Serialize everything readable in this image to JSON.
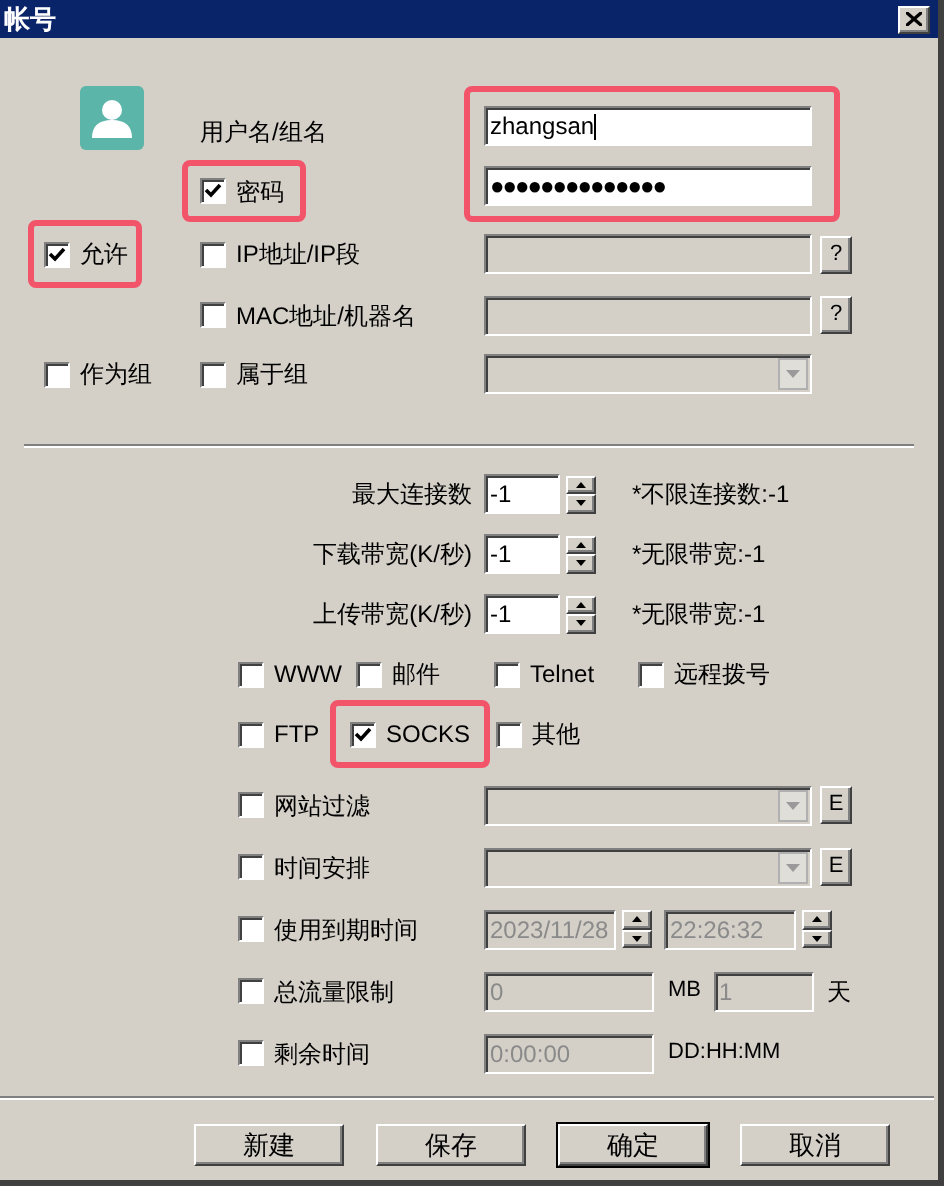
{
  "window": {
    "title": "帐号"
  },
  "identity": {
    "username_label": "用户名/组名",
    "username": "zhangsan",
    "password_value": "●●●●●●●●●●●●●●",
    "fields_highlighted": true
  },
  "password": {
    "label": "密码",
    "checked": true,
    "highlighted": true
  },
  "allow": {
    "label": "允许",
    "checked": true,
    "highlighted": true
  },
  "bindings": [
    {
      "label": "IP地址/IP段",
      "checked": false,
      "help": "?"
    },
    {
      "label": "MAC地址/机器名",
      "checked": false,
      "help": "?"
    }
  ],
  "as_group": {
    "label": "作为组",
    "checked": false
  },
  "member_of": {
    "label": "属于组",
    "checked": false
  },
  "limits": [
    {
      "label": "最大连接数",
      "value": "-1",
      "note": "*不限连接数:-1"
    },
    {
      "label": "下载带宽(K/秒)",
      "value": "-1",
      "note": "*无限带宽:-1"
    },
    {
      "label": "上传带宽(K/秒)",
      "value": "-1",
      "note": "*无限带宽:-1"
    }
  ],
  "services": [
    [
      {
        "label": "WWW",
        "checked": false,
        "highlighted": false
      },
      {
        "label": "邮件",
        "checked": false,
        "highlighted": false
      },
      {
        "label": "Telnet",
        "checked": false,
        "highlighted": false
      },
      {
        "label": "远程拨号",
        "checked": false,
        "highlighted": false
      }
    ],
    [
      {
        "label": "FTP",
        "checked": false,
        "highlighted": false
      },
      {
        "label": "SOCKS",
        "checked": true,
        "highlighted": true
      },
      {
        "label": "其他",
        "checked": false,
        "highlighted": false
      }
    ]
  ],
  "options": [
    {
      "kind": "combo",
      "label": "网站过滤",
      "checked": false,
      "edit": "E"
    },
    {
      "kind": "combo",
      "label": "时间安排",
      "checked": false,
      "edit": "E"
    },
    {
      "kind": "datetime",
      "label": "使用到期时间",
      "checked": false,
      "date": "2023/11/28",
      "time": "22:26:32"
    },
    {
      "kind": "traffic",
      "label": "总流量限制",
      "checked": false,
      "amount": "0",
      "unit": "MB",
      "days": "1",
      "days_unit": "天"
    },
    {
      "kind": "duration",
      "label": "剩余时间",
      "checked": false,
      "value": "0:00:00",
      "format": "DD:HH:MM"
    }
  ],
  "buttons": [
    {
      "label": "新建",
      "default": false
    },
    {
      "label": "保存",
      "default": false
    },
    {
      "label": "确定",
      "default": true
    },
    {
      "label": "取消",
      "default": false
    }
  ]
}
